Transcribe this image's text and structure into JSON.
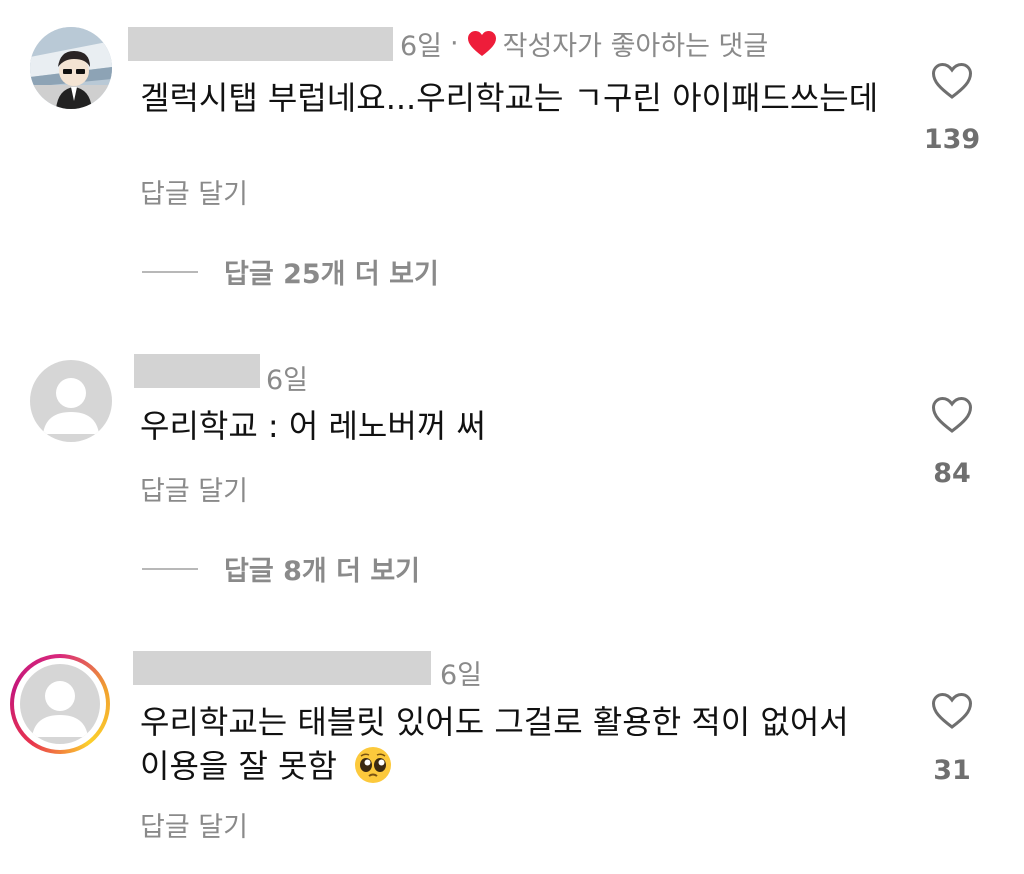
{
  "comments": [
    {
      "time": "6일",
      "separator": "·",
      "liked_by_author": "작성자가 좋아하는 댓글",
      "text": "겔럭시탭 부럽네요...우리학교는 ㄱ구린 아이패드쓰는데",
      "reply_label": "답글 달기",
      "more_replies": "답글 25개 더 보기",
      "likes": "139",
      "avatar_icon": "profile-photo-icon"
    },
    {
      "time": "6일",
      "text": "우리학교 : 어 레노버꺼 써",
      "reply_label": "답글 달기",
      "more_replies": "답글 8개 더 보기",
      "likes": "84",
      "avatar_icon": "default-user-icon"
    },
    {
      "time": "6일",
      "text": "우리학교는 태블릿 있어도 그걸로 활용한 적이 없어서 이용을 잘 못함",
      "emoji": "pleading-face-emoji",
      "reply_label": "답글 달기",
      "likes": "31",
      "avatar_icon": "default-user-icon",
      "story_ring": true
    }
  ],
  "colors": {
    "heart_red": "#ee1d3a",
    "meta_grey": "#8a8a8a",
    "placeholder_grey": "#d3d3d3",
    "story_ring": [
      "#d8287c",
      "#f1a12e",
      "#fcd02c"
    ]
  }
}
